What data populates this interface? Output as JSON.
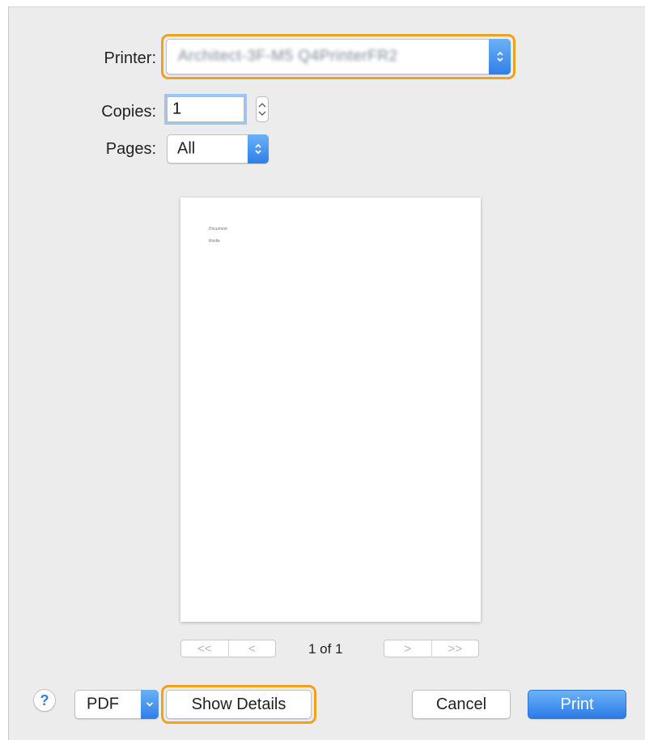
{
  "printer": {
    "label": "Printer:",
    "value": "Architect-3F-M5 Q4PrinterFR2"
  },
  "copies": {
    "label": "Copies:",
    "value": "1"
  },
  "pages": {
    "label": "Pages:",
    "value": "All"
  },
  "preview": {
    "line1": "Document",
    "line2": "Kindle",
    "first_label": "<<",
    "prev_label": "<",
    "next_label": ">",
    "last_label": ">>",
    "page_indicator": "1 of 1"
  },
  "footer": {
    "help_label": "?",
    "pdf_label": "PDF",
    "show_details_label": "Show Details",
    "cancel_label": "Cancel",
    "print_label": "Print"
  },
  "colors": {
    "accent": "#2f7fe8",
    "highlight": "#f0a11e",
    "dialog_bg": "#ececec"
  }
}
